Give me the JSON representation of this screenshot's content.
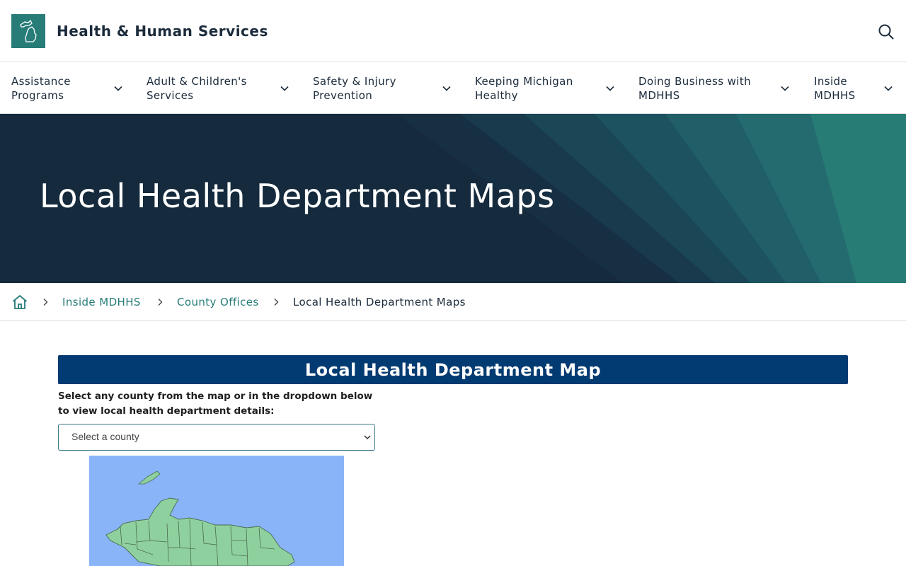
{
  "header": {
    "site_title": "Health & Human Services",
    "logo_icon": "michigan-state-icon",
    "search_icon": "search-icon"
  },
  "nav": {
    "items": [
      {
        "label": "Assistance Programs"
      },
      {
        "label": "Adult & Children's Services"
      },
      {
        "label": "Safety & Injury Prevention"
      },
      {
        "label": "Keeping Michigan Healthy"
      },
      {
        "label": "Doing Business with MDHHS"
      },
      {
        "label": "Inside MDHHS"
      }
    ]
  },
  "hero": {
    "title": "Local Health Department Maps"
  },
  "breadcrumb": {
    "home_icon": "home-icon",
    "items": [
      {
        "label": "Inside MDHHS"
      },
      {
        "label": "County Offices"
      }
    ],
    "current": "Local Health Department Maps"
  },
  "map_section": {
    "title": "Local Health Department Map",
    "instructions": "Select any county from the map or in the dropdown below to view local health department details:",
    "select": {
      "selected": "Select a county"
    }
  },
  "colors": {
    "brand_teal": "#277c78",
    "hero_navy": "#152a3d",
    "banner_blue": "#023a72",
    "map_water": "#8ab4f8",
    "map_land": "#8fd19e"
  }
}
